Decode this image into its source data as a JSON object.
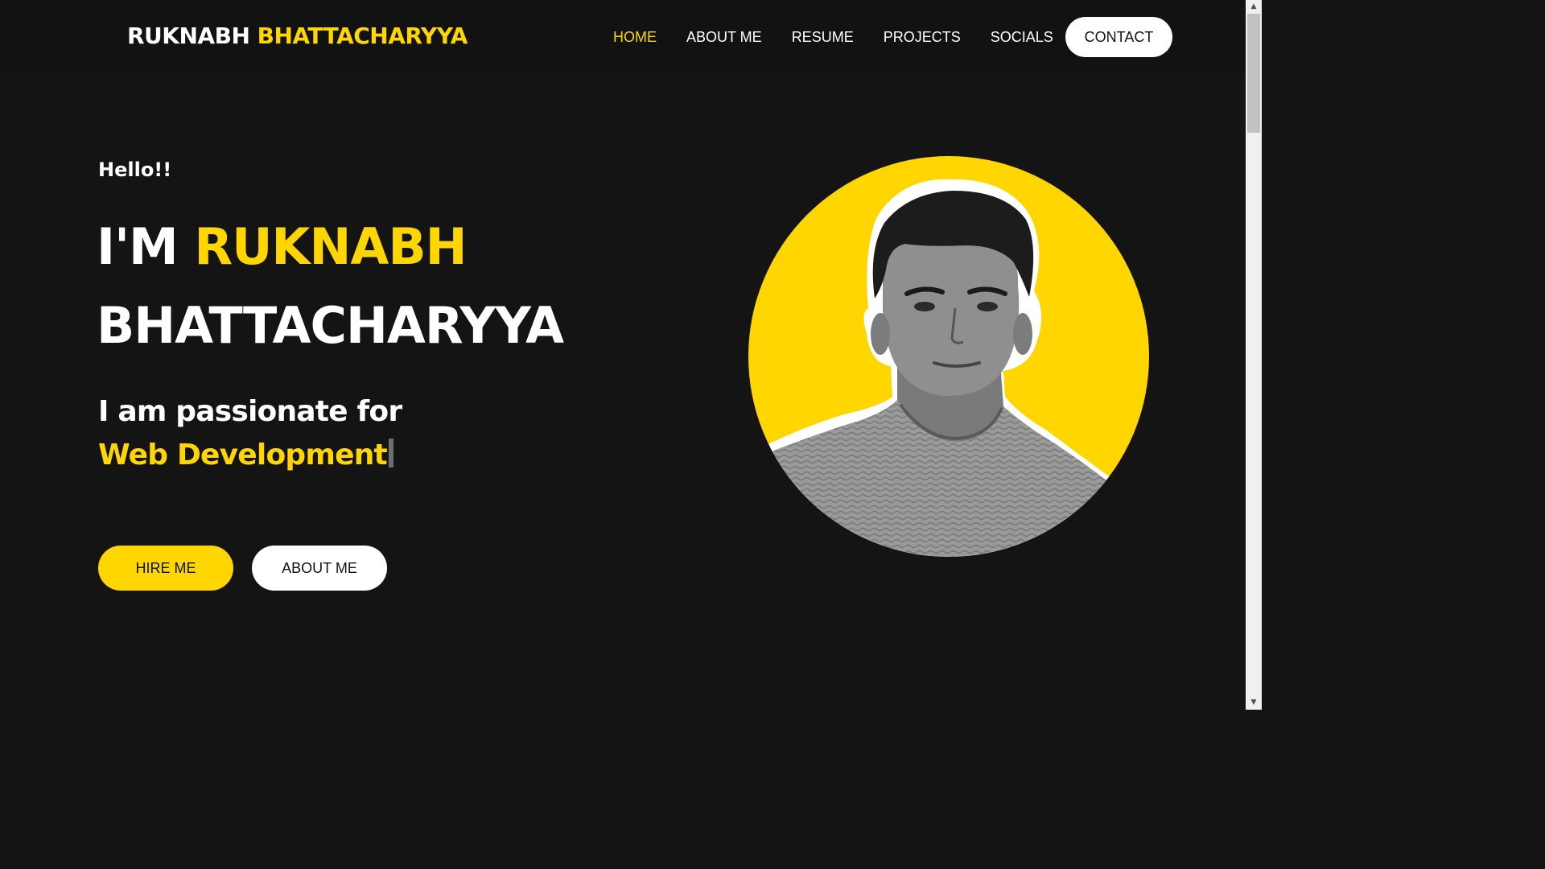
{
  "navbar": {
    "logo_first": "RUKNABH",
    "logo_last": "BHATTACHARYYA",
    "links": [
      {
        "label": "HOME",
        "active": true
      },
      {
        "label": "ABOUT ME",
        "active": false
      },
      {
        "label": "RESUME",
        "active": false
      },
      {
        "label": "PROJECTS",
        "active": false
      },
      {
        "label": "SOCIALS",
        "active": false
      }
    ],
    "contact_label": "CONTACT"
  },
  "hero": {
    "greeting": "Hello!!",
    "headline_prefix": "I'M",
    "headline_first": "RUKNABH",
    "headline_last": "BHATTACHARYYA",
    "tagline_prefix": "I am passionate for",
    "tagline_typed": "Web Development",
    "hire_label": "HIRE ME",
    "about_label": "ABOUT ME"
  },
  "portrait": {
    "circle_color": "#ffd600",
    "style": "black-and-white cutout photo"
  },
  "colors": {
    "background": "#141414",
    "accent": "#ffd600",
    "text": "#ffffff"
  },
  "scrollbar": {
    "position_fraction": 0.0
  }
}
